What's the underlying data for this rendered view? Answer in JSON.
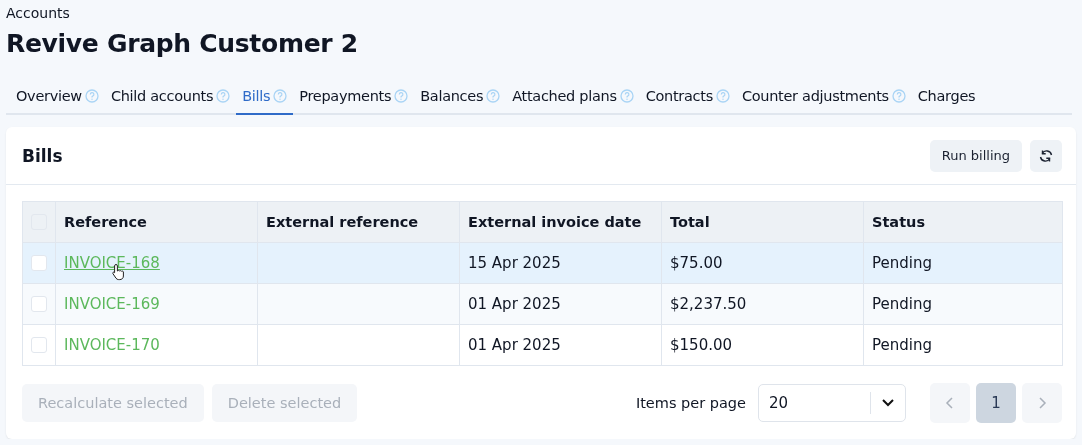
{
  "breadcrumb": "Accounts",
  "title": "Revive Graph Customer 2",
  "tabs": [
    {
      "label": "Overview",
      "help": true,
      "selected": false
    },
    {
      "label": "Child accounts",
      "help": true,
      "selected": false
    },
    {
      "label": "Bills",
      "help": true,
      "selected": true
    },
    {
      "label": "Prepayments",
      "help": true,
      "selected": false
    },
    {
      "label": "Balances",
      "help": true,
      "selected": false
    },
    {
      "label": "Attached plans",
      "help": true,
      "selected": false
    },
    {
      "label": "Contracts",
      "help": true,
      "selected": false
    },
    {
      "label": "Counter adjustments",
      "help": true,
      "selected": false
    },
    {
      "label": "Charges",
      "help": false,
      "selected": false
    }
  ],
  "card": {
    "title": "Bills",
    "actions": [
      "Run billing"
    ],
    "table": {
      "columns": [
        "Reference",
        "External reference",
        "External invoice date",
        "Total",
        "Status"
      ],
      "all_checked": false,
      "rows": [
        {
          "checked": false,
          "hovered": true,
          "cells": [
            "INVOICE-168",
            "",
            "15 Apr 2025",
            "$75.00",
            "Pending"
          ]
        },
        {
          "checked": false,
          "hovered": false,
          "cells": [
            "INVOICE-169",
            "",
            "01 Apr 2025",
            "$2,237.50",
            "Pending"
          ]
        },
        {
          "checked": false,
          "hovered": false,
          "cells": [
            "INVOICE-170",
            "",
            "01 Apr 2025",
            "$150.00",
            "Pending"
          ]
        }
      ]
    },
    "footer_buttons": [
      {
        "label": "Recalculate selected",
        "disabled": true
      },
      {
        "label": "Delete selected",
        "disabled": true
      }
    ],
    "pagination": {
      "items_label": "Items per page",
      "page_size": "20",
      "prev_disabled": true,
      "next_disabled": true,
      "pages": [
        {
          "label": "1",
          "selected": true
        }
      ]
    }
  }
}
